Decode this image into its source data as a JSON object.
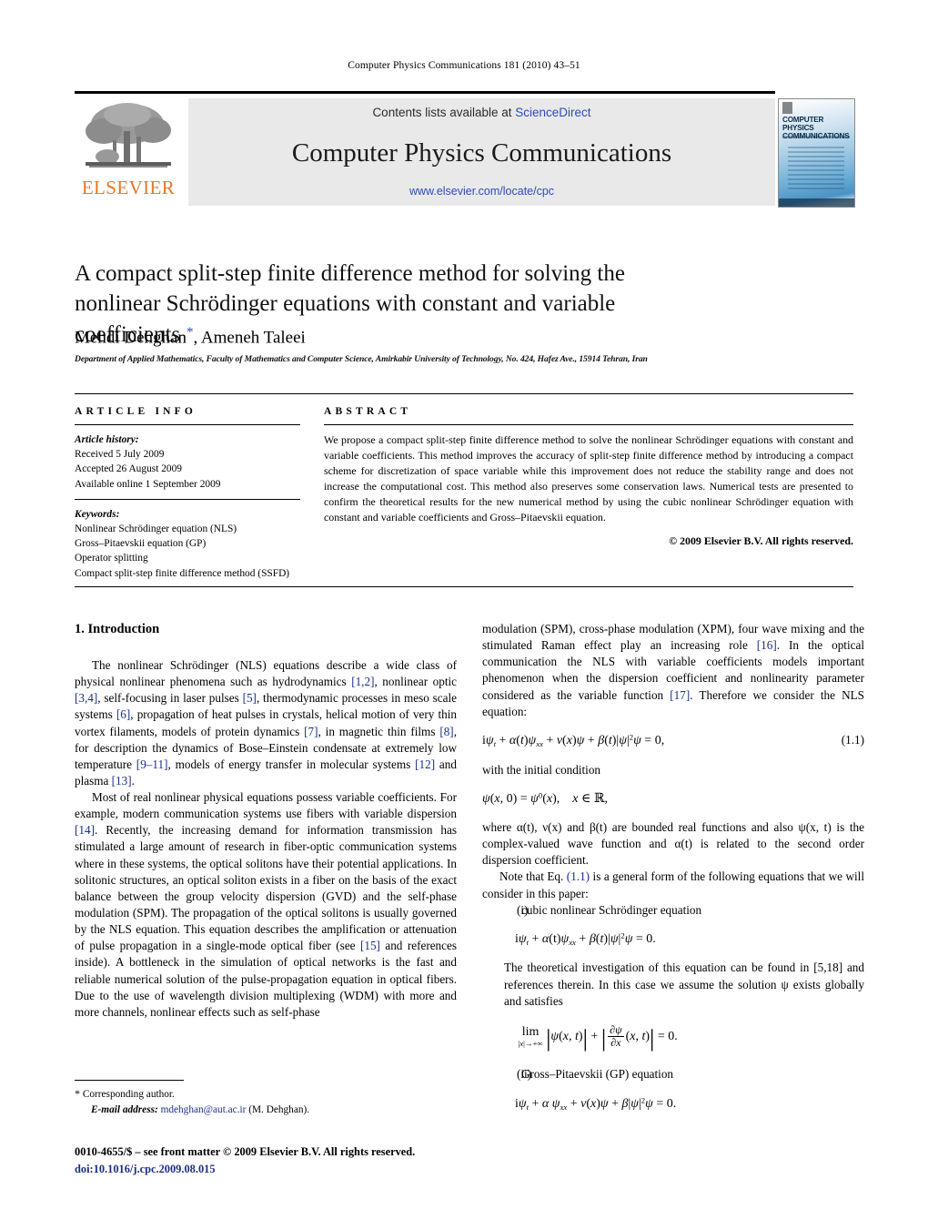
{
  "running_head": "Computer Physics Communications 181 (2010) 43–51",
  "masthead": {
    "contents_prefix": "Contents lists available at ",
    "sciencedirect": "ScienceDirect",
    "journal_name": "Computer Physics Communications",
    "journal_url": "www.elsevier.com/locate/cpc",
    "publisher_logo_text": "ELSEVIER",
    "cover_title": "COMPUTER PHYSICS COMMUNICATIONS"
  },
  "article": {
    "title": "A compact split-step finite difference method for solving the nonlinear Schrödinger equations with constant and variable coefficients",
    "authors": "Mehdi Dehghan",
    "authors_tail": ", Ameneh Taleei",
    "corresponding_marker": "*",
    "affiliation": "Department of Applied Mathematics, Faculty of Mathematics and Computer Science, Amirkabir University of Technology, No. 424, Hafez Ave., 15914 Tehran, Iran"
  },
  "info": {
    "heading": "ARTICLE INFO",
    "history_label": "Article history:",
    "history": [
      "Received 5 July 2009",
      "Accepted 26 August 2009",
      "Available online 1 September 2009"
    ],
    "keywords_label": "Keywords:",
    "keywords": [
      "Nonlinear Schrödinger equation (NLS)",
      "Gross–Pitaevskii equation (GP)",
      "Operator splitting",
      "Compact split-step finite difference method (SSFD)"
    ]
  },
  "abstract": {
    "heading": "ABSTRACT",
    "text": "We propose a compact split-step finite difference method to solve the nonlinear Schrödinger equations with constant and variable coefficients. This method improves the accuracy of split-step finite difference method by introducing a compact scheme for discretization of space variable while this improvement does not reduce the stability range and does not increase the computational cost. This method also preserves some conservation laws. Numerical tests are presented to confirm the theoretical results for the new numerical method by using the cubic nonlinear Schrödinger equation with constant and variable coefficients and Gross–Pitaevskii equation.",
    "copyright": "© 2009 Elsevier B.V. All rights reserved."
  },
  "introduction": {
    "heading": "1. Introduction",
    "left_paragraphs": [
      "The nonlinear Schrödinger (NLS) equations describe a wide class of physical nonlinear phenomena such as hydrodynamics [1,2], nonlinear optic [3,4], self-focusing in laser pulses [5], thermodynamic processes in meso scale systems [6], propagation of heat pulses in crystals, helical motion of very thin vortex filaments, models of protein dynamics [7], in magnetic thin films [8], for description the dynamics of Bose–Einstein condensate at extremely low temperature [9–11], models of energy transfer in molecular systems [12] and plasma [13].",
      "Most of real nonlinear physical equations possess variable coefficients. For example, modern communication systems use fibers with variable dispersion [14]. Recently, the increasing demand for information transmission has stimulated a large amount of research in fiber-optic communication systems where in these systems, the optical solitons have their potential applications. In solitonic structures, an optical soliton exists in a fiber on the basis of the exact balance between the group velocity dispersion (GVD) and the self-phase modulation (SPM). The propagation of the optical solitons is usually governed by the NLS equation. This equation describes the amplification or attenuation of pulse propagation in a single-mode optical fiber (see [15] and references inside). A bottleneck in the simulation of optical networks is the fast and reliable numerical solution of the pulse-propagation equation in optical fibers. Due to the use of wavelength division multiplexing (WDM) with more and more channels, nonlinear effects such as self-phase"
    ],
    "right_intro_paragraph": "modulation (SPM), cross-phase modulation (XPM), four wave mixing and the stimulated Raman effect play an increasing role [16]. In the optical communication the NLS with variable coefficients models important phenomenon when the dispersion coefficient and nonlinearity parameter considered as the variable function [17]. Therefore we consider the NLS equation:",
    "eq_1_1_tag": "(1.1)",
    "initial_condition_lead": "with the initial condition",
    "where_paragraph": "where α(t), ν(x) and β(t) are bounded real functions and also ψ(x, t) is the complex-valued wave function and α(t) is related to the second order dispersion coefficient.",
    "note_paragraph_pre": "Note that Eq. ",
    "note_eq_ref": "(1.1)",
    "note_paragraph_post": " is a general form of the following equations that we will consider in this paper:",
    "item_i_label": "(i)",
    "item_i_text": "cubic nonlinear Schrödinger equation",
    "item_i_follow": "The theoretical investigation of this equation can be found in [5,18] and references therein. In this case we assume the solution ψ exists globally and satisfies",
    "item_ii_label": "(ii)",
    "item_ii_text": "Gross–Pitaevskii (GP) equation"
  },
  "footer": {
    "corresponding_star": "*",
    "corresponding_text": "Corresponding author.",
    "email_label": "E-mail address:",
    "email": "mdehghan@aut.ac.ir",
    "email_owner": "(M. Dehghan).",
    "issn_line": "0010-4655/$ – see front matter  © 2009 Elsevier B.V. All rights reserved.",
    "doi": "doi:10.1016/j.cpc.2009.08.015"
  }
}
